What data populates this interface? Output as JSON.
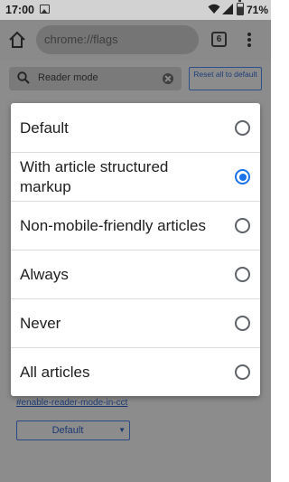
{
  "status_bar": {
    "time": "17:00",
    "battery_pct": "71%"
  },
  "toolbar": {
    "url": "chrome://flags",
    "tab_count": "6"
  },
  "flags_page": {
    "search_value": "Reader mode",
    "reset_label": "Reset all to default",
    "flag_anchor": "#enable-reader-mode-in-cct",
    "flag_select_value": "Default"
  },
  "dialog": {
    "selected_index": 1,
    "options": [
      "Default",
      "With article structured markup",
      "Non-mobile-friendly articles",
      "Always",
      "Never",
      "All articles"
    ]
  },
  "colors": {
    "accent": "#1a73e8",
    "link": "#1c3a72"
  }
}
